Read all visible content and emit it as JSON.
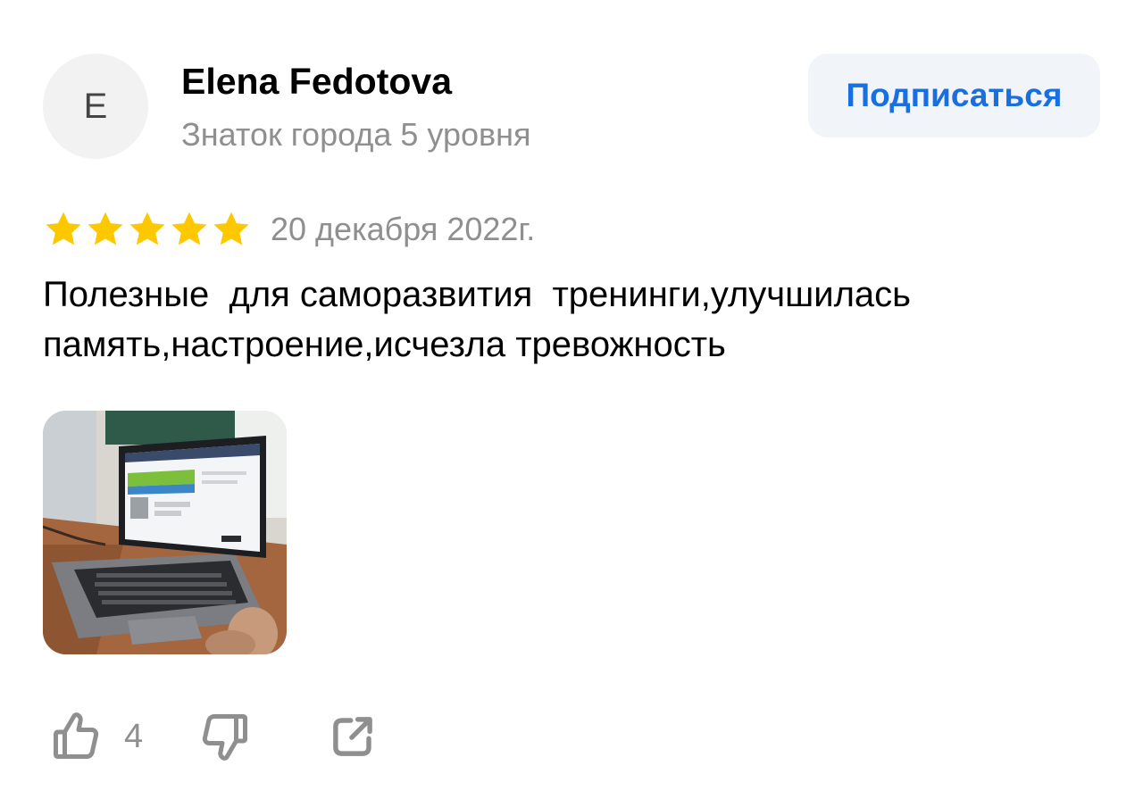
{
  "author": {
    "initial": "E",
    "name": "Elena Fedotova",
    "level": "Знаток города 5 уровня"
  },
  "subscribe_label": "Подписаться",
  "review": {
    "rating": 5,
    "rating_max": 5,
    "date": "20 декабря 2022г.",
    "text": "Полезные  для саморазвития  тренинги,улучшилась\nпамять,настроение,исчезла тревожность"
  },
  "photo": {
    "icon": "laptop-photo"
  },
  "actions": {
    "like_count": "4",
    "like_icon": "thumbs-up-icon",
    "dislike_icon": "thumbs-down-icon",
    "share_icon": "share-icon"
  },
  "colors": {
    "star": "#fdc800",
    "link": "#1a6fe0",
    "secondary_text": "#8f8f8f",
    "button_bg": "#f1f4f8"
  }
}
